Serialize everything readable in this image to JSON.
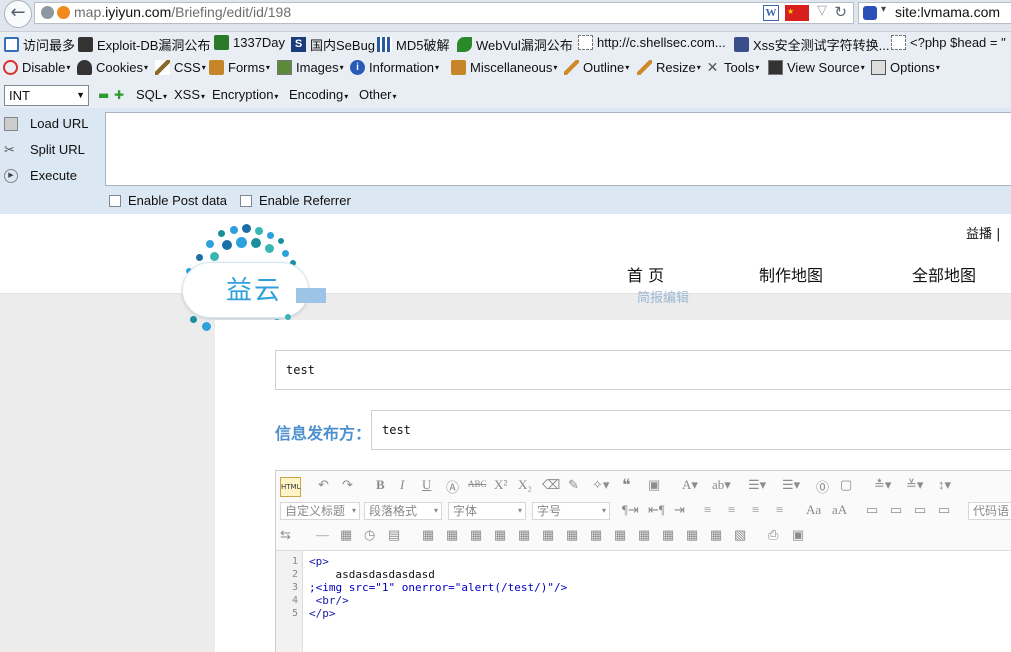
{
  "address_bar": {
    "url_prefix": "map.",
    "url_domain": "iyiyun.com",
    "url_path": "/Briefing/edit/id/198",
    "search_text": "site:lvmama.com",
    "flag_label": "★"
  },
  "bookmarks": [
    {
      "label": "访问最多",
      "icon": "folder-icon",
      "color": "#3470b8"
    },
    {
      "label": "Exploit-DB漏洞公布",
      "icon": "exploit-icon",
      "color": "#333333"
    },
    {
      "label": "1337Day",
      "icon": "1337day-icon",
      "color": "#2a7a2a"
    },
    {
      "label": "国内SeBug",
      "icon": "sebug-icon",
      "color": "#1b3c7a"
    },
    {
      "label": "MD5破解",
      "icon": "grid-icon",
      "color": "#2a5aa0"
    },
    {
      "label": "WebVul漏洞公布",
      "icon": "leaf-icon",
      "color": "#2a8a2a"
    },
    {
      "label": "http://c.shellsec.com...",
      "icon": "page-icon",
      "color": "#ffffff"
    },
    {
      "label": "Xss安全测试字符转换...",
      "icon": "xss-icon",
      "color": "#3a4f8a"
    },
    {
      "label": "<?php $head = \"",
      "icon": "page-icon",
      "color": "#ffffff"
    }
  ],
  "devbar": [
    {
      "label": "Disable",
      "icon": "disable-icon",
      "color": "#d9312b"
    },
    {
      "label": "Cookies",
      "icon": "cookies-icon",
      "color": "#333333"
    },
    {
      "label": "CSS",
      "icon": "css-icon",
      "color": "#8a6a2a"
    },
    {
      "label": "Forms",
      "icon": "forms-icon",
      "color": "#c7852a"
    },
    {
      "label": "Images",
      "icon": "images-icon",
      "color": "#5a8a3a"
    },
    {
      "label": "Information",
      "icon": "information-icon",
      "color": "#2a5ab8"
    },
    {
      "label": "Miscellaneous",
      "icon": "miscellaneous-icon",
      "color": "#c7852a"
    },
    {
      "label": "Outline",
      "icon": "outline-icon",
      "color": "#d08a2a"
    },
    {
      "label": "Resize",
      "icon": "resize-icon",
      "color": "#d08a2a"
    },
    {
      "label": "Tools",
      "icon": "tools-icon",
      "color": "#555555"
    },
    {
      "label": "View Source",
      "icon": "view-source-icon",
      "color": "#333333"
    },
    {
      "label": "Options",
      "icon": "options-icon",
      "color": "#555555"
    }
  ],
  "hackbar": {
    "select_value": "INT",
    "menus": [
      "SQL",
      "XSS",
      "Encryption",
      "Encoding",
      "Other"
    ],
    "load_url": "Load URL",
    "split_url": "Split URL",
    "execute": "Execute",
    "enable_post": "Enable Post data",
    "enable_referrer": "Enable Referrer",
    "url_value": ""
  },
  "site": {
    "user_text": "益播",
    "user_sep": "|",
    "logo_text": "益云",
    "nav": [
      "首 页",
      "制作地图",
      "全部地图"
    ],
    "nav_sub": "简报编辑",
    "title_value": "test",
    "publisher_label": "信息发布方：",
    "publisher_value": "test",
    "editor_selects": [
      "自定义标题",
      "段落格式",
      "字体",
      "字号"
    ],
    "editor_right_label": "代码语",
    "code_lines": [
      {
        "num": "1",
        "text": "<p>"
      },
      {
        "num": "2",
        "text": "    asdasdasdasdasd"
      },
      {
        "num": "3",
        "text": ";<img src=\"1\" onerror=\"alert(/test/)\"/>"
      },
      {
        "num": "4",
        "text": " <br/>"
      },
      {
        "num": "5",
        "text": "</p>"
      }
    ]
  },
  "colors": {
    "accent_blue": "#4d8fcf",
    "logo_blue": "#2ea1dc",
    "hackbar_bg": "#dbe7f3"
  }
}
